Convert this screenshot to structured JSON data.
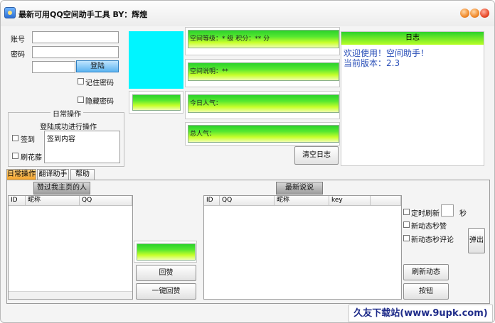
{
  "window": {
    "title": "最新可用QQ空间助手工具 BY：辉煌"
  },
  "login": {
    "account_label": "账号",
    "password_label": "密码",
    "login_button": "登陆",
    "remember_label": "记住密码",
    "hide_label": "隐藏密码"
  },
  "daily_ops": {
    "group_title": "日常操作",
    "hint": "登陆成功进行操作",
    "checkin_label": "签到",
    "flower_label": "刷花藤",
    "checkin_content_placeholder": "签到内容"
  },
  "space_info": {
    "level_text": "空间等级：* 级      积分：** 分",
    "desc_text": "空间说明：**",
    "today_text": "今日人气：",
    "total_text": "总人气："
  },
  "log": {
    "header": "日志",
    "lines": [
      "欢迎使用！空间助手！",
      "当前版本：2.3"
    ],
    "clear_button": "清空日志"
  },
  "tabs": [
    "日常操作",
    "翻译助手",
    "帮助"
  ],
  "visitors": {
    "tab_label": "赞过我主页的人",
    "columns": [
      "ID",
      "昵称",
      "QQ"
    ],
    "reply_button": "回赞",
    "one_click_button": "一键回赞"
  },
  "feed": {
    "tab_label": "最新说说",
    "columns": [
      "ID",
      "QQ",
      "昵称",
      "key"
    ],
    "timer_label": "定时刷新",
    "seconds_label": "秒",
    "auto_like_label": "新动态秒赞",
    "auto_comment_label": "新动态秒评论",
    "popup_button": "弹出",
    "refresh_button": "刷新动态",
    "button_label": "按钮"
  },
  "watermark": {
    "text": "久友下载站(www.9upk.com)"
  }
}
